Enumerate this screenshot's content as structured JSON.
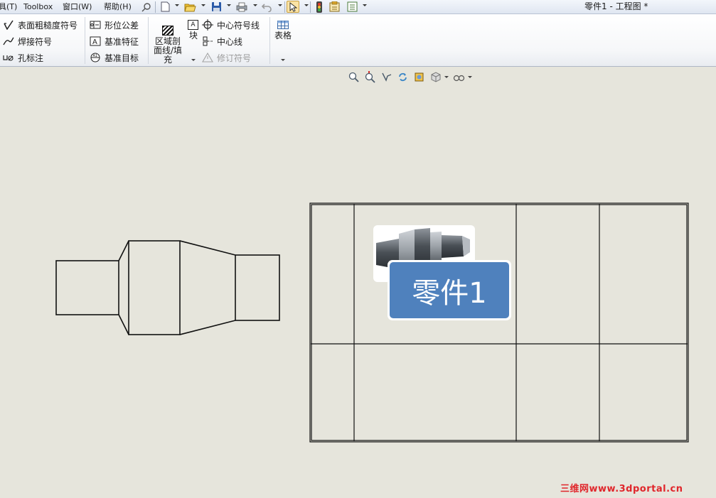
{
  "menubar": {
    "items": [
      "具(T)",
      "Toolbox",
      "窗口(W)",
      "帮助(H)"
    ],
    "window_title": "零件1 - 工程图 *"
  },
  "ribbon": {
    "col1": [
      "表面粗糙度符号",
      "焊接符号",
      "孔标注"
    ],
    "col2": [
      "形位公差",
      "基准特征",
      "基准目标"
    ],
    "area_hatch": [
      "区域剖",
      "面线/填",
      "充"
    ],
    "block": "块",
    "col4": [
      "中心符号线",
      "中心线",
      "修订符号"
    ],
    "table": "表格"
  },
  "drawing": {
    "part_label": "零件1"
  },
  "watermark": "三维网www.3dportal.cn",
  "colors": {
    "canvas": "#e6e5dc",
    "label_fill": "#4f81bd",
    "watermark": "#e0262b"
  }
}
